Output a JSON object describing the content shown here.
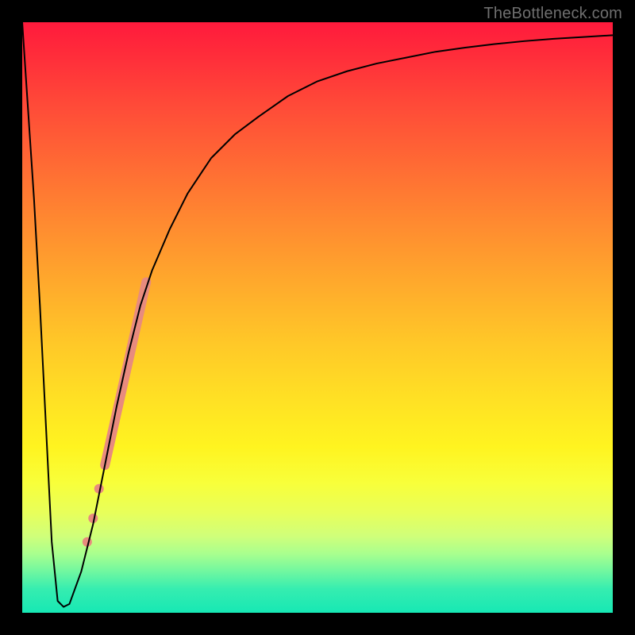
{
  "watermark": "TheBottleneck.com",
  "chart_data": {
    "type": "line",
    "title": "",
    "xlabel": "",
    "ylabel": "",
    "xlim": [
      0,
      100
    ],
    "ylim": [
      0,
      100
    ],
    "grid": false,
    "legend": false,
    "background": {
      "type": "vertical-gradient",
      "stops": [
        {
          "pos": 0,
          "color": "#ff1a3c"
        },
        {
          "pos": 24,
          "color": "#ff6a34"
        },
        {
          "pos": 54,
          "color": "#ffc728"
        },
        {
          "pos": 78,
          "color": "#f8ff3a"
        },
        {
          "pos": 100,
          "color": "#17e8b4"
        }
      ]
    },
    "series": [
      {
        "name": "bottleneck-curve",
        "color": "#000000",
        "x": [
          0,
          1,
          2,
          3,
          4,
          5,
          6,
          7,
          8,
          10,
          12,
          14,
          16,
          18,
          20,
          22,
          25,
          28,
          32,
          36,
          40,
          45,
          50,
          55,
          60,
          65,
          70,
          75,
          80,
          85,
          90,
          95,
          100
        ],
        "y": [
          100,
          85,
          70,
          52,
          32,
          12,
          2,
          1,
          1.5,
          7,
          15,
          25,
          35,
          44,
          52,
          58,
          65,
          71,
          77,
          81,
          84,
          87.5,
          90,
          91.7,
          93,
          94,
          95,
          95.7,
          96.3,
          96.8,
          97.2,
          97.5,
          97.8
        ]
      }
    ],
    "annotations": [
      {
        "name": "highlight-segment",
        "type": "thick-line",
        "color": "#e88b7e",
        "width": 12,
        "x": [
          14,
          21
        ],
        "y": [
          25,
          56
        ]
      },
      {
        "name": "highlight-dot-1",
        "type": "dot",
        "color": "#e88b7e",
        "r": 6,
        "x": 13,
        "y": 21
      },
      {
        "name": "highlight-dot-2",
        "type": "dot",
        "color": "#e88b7e",
        "r": 6,
        "x": 12,
        "y": 16
      },
      {
        "name": "highlight-dot-3",
        "type": "dot",
        "color": "#e88b7e",
        "r": 6,
        "x": 11,
        "y": 12
      }
    ]
  }
}
